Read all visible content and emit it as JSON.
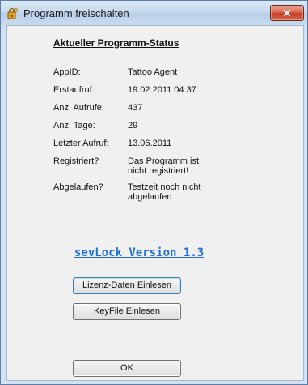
{
  "window": {
    "title": "Programm freischalten",
    "close_label": "✕"
  },
  "status": {
    "heading": "Aktueller Programm-Status",
    "rows": [
      {
        "label": "AppID:",
        "value": "Tattoo Agent"
      },
      {
        "label": "Erstaufruf:",
        "value": "19.02.2011 04:37"
      },
      {
        "label": "Anz. Aufrufe:",
        "value": "437"
      },
      {
        "label": "Anz. Tage:",
        "value": "29"
      },
      {
        "label": "Letzter Aufruf:",
        "value": "13.06.2011"
      },
      {
        "label": "Registriert?",
        "value": "Das Programm ist nicht registriert!"
      },
      {
        "label": "Abgelaufen?",
        "value": "Testzeit noch nicht abgelaufen"
      }
    ]
  },
  "product_link": "sevLock Version 1.3",
  "buttons": {
    "read_license": "Lizenz-Daten Einlesen",
    "read_keyfile": "KeyFile Einlesen",
    "ok": "OK"
  },
  "colors": {
    "link": "#1f6fd6",
    "close_button": "#c33c23"
  }
}
